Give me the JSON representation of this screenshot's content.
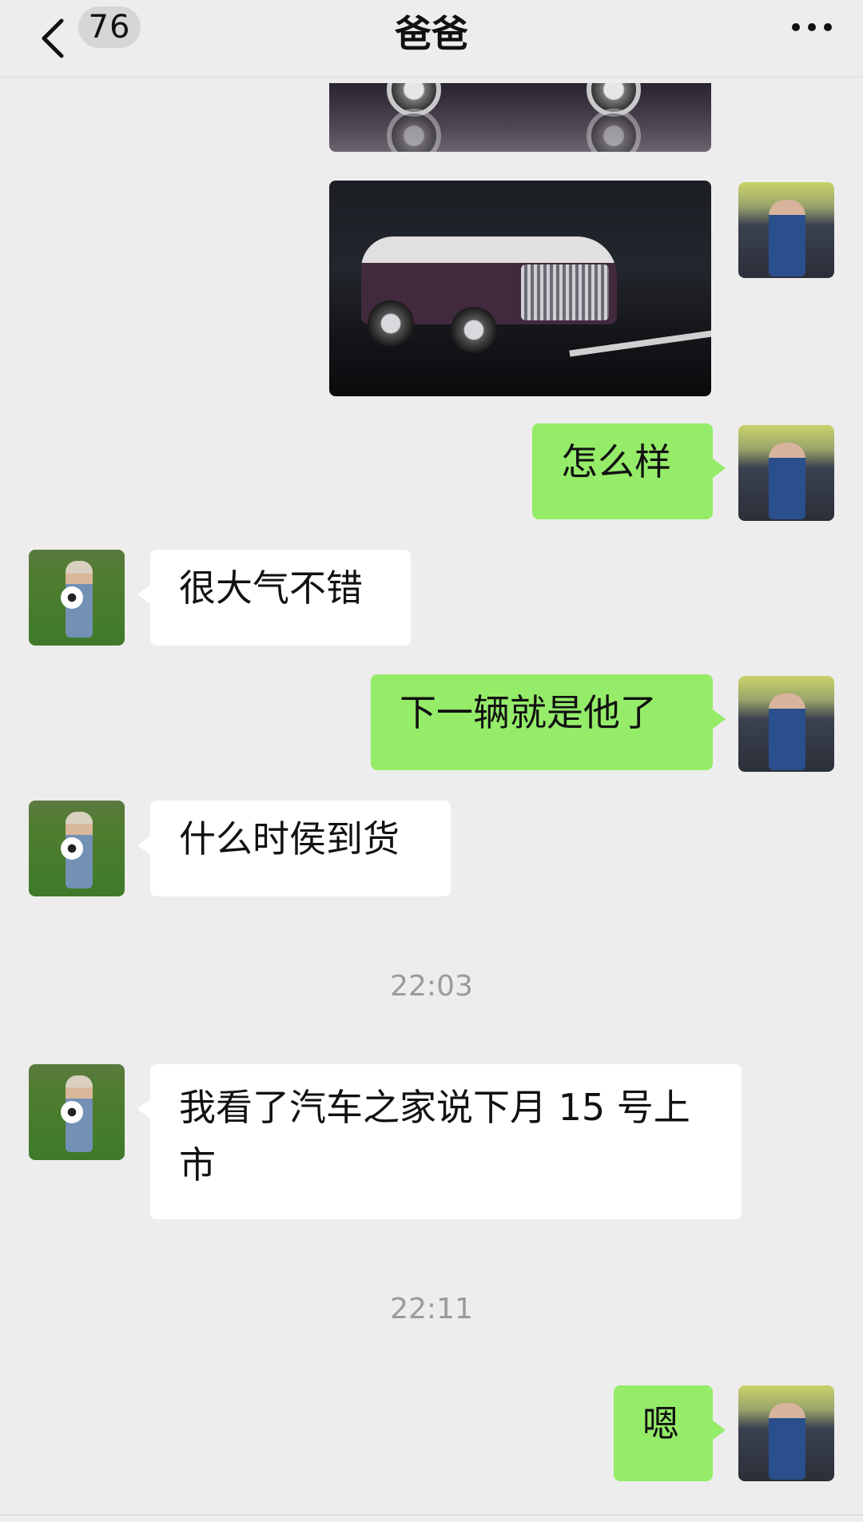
{
  "header": {
    "back_icon": "chevron-left-icon",
    "unread_count": "76",
    "title": "爸爸",
    "more_icon": "more-horizontal-icon"
  },
  "messages": [
    {
      "sender": "self",
      "type": "image",
      "content": "car-photo-partial"
    },
    {
      "sender": "self",
      "type": "image",
      "content": "car-photo"
    },
    {
      "sender": "self",
      "type": "text",
      "text": "怎么样"
    },
    {
      "sender": "other",
      "type": "text",
      "text": "很大气不错"
    },
    {
      "sender": "self",
      "type": "text",
      "text": "下一辆就是他了"
    },
    {
      "sender": "other",
      "type": "text",
      "text": "什么时侯到货"
    },
    {
      "type": "timestamp",
      "text": "22:03"
    },
    {
      "sender": "other",
      "type": "text",
      "text_line1": "我看了汽车之家说下月 15 号上",
      "text_line2": "市"
    },
    {
      "type": "timestamp",
      "text": "22:11"
    },
    {
      "sender": "self",
      "type": "text",
      "text": "嗯"
    }
  ],
  "colors": {
    "background": "#ededed",
    "self_bubble": "#95ec69",
    "other_bubble": "#ffffff",
    "timestamp": "#9b9b9b"
  }
}
